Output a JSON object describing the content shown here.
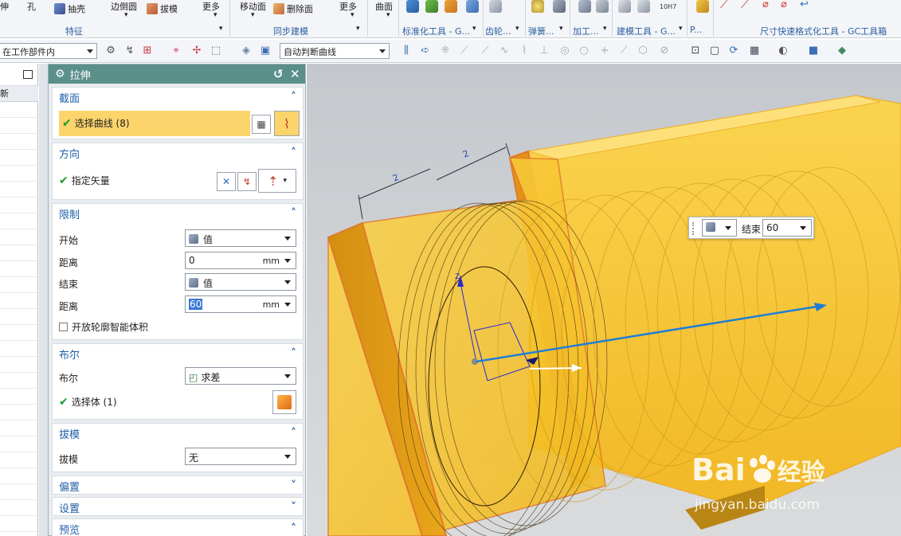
{
  "ribbon": {
    "top_items": [
      {
        "label": "伸",
        "name": "extrude-cut-label"
      },
      {
        "label": "孔",
        "name": "hole-label"
      },
      {
        "label": "抽壳",
        "name": "shell-button"
      },
      {
        "label": "边倒圆",
        "name": "edge-blend-button"
      },
      {
        "label": "拔模",
        "name": "draft-button"
      },
      {
        "label": "更多",
        "name": "more-feature-button"
      },
      {
        "label": "移动面",
        "name": "move-face-button"
      },
      {
        "label": "删除面",
        "name": "delete-face-button"
      },
      {
        "label": "更多",
        "name": "more-sync-button"
      },
      {
        "label": "曲面",
        "name": "surface-button"
      }
    ],
    "groups": [
      {
        "label": "特征",
        "name": "group-feature"
      },
      {
        "label": "同步建模",
        "name": "group-sync-modeling"
      },
      {
        "label": "标准化工具 - G...",
        "name": "group-standard-tools"
      },
      {
        "label": "齿轮...",
        "name": "group-gear"
      },
      {
        "label": "弹簧...",
        "name": "group-spring"
      },
      {
        "label": "加工...",
        "name": "group-machining"
      },
      {
        "label": "建模工具 - G...",
        "name": "group-modeling-tools"
      },
      {
        "label": "P...",
        "name": "group-p"
      },
      {
        "label": "尺寸快速格式化工具 - GC工具箱",
        "name": "group-dimension-format"
      }
    ],
    "badge": "10H7"
  },
  "cmdbar": {
    "scope_select": "在工作部件内",
    "curve_rule_select": "自动判断曲线"
  },
  "navigator": {
    "column_label": "新"
  },
  "dialog": {
    "title": "拉伸",
    "section": {
      "title": "截面",
      "select_curve": "选择曲线 (8)"
    },
    "direction": {
      "title": "方向",
      "specify_vector": "指定矢量"
    },
    "limits": {
      "title": "限制",
      "start_label": "开始",
      "start_value": "值",
      "start_distance_label": "距离",
      "start_distance": "0",
      "end_label": "结束",
      "end_value": "值",
      "end_distance_label": "距离",
      "end_distance": "60",
      "unit": "mm",
      "open_profile": "开放轮廓智能体积"
    },
    "boolean": {
      "title": "布尔",
      "label": "布尔",
      "value": "求差",
      "select_body": "选择体 (1)"
    },
    "draft": {
      "title": "拔模",
      "label": "拔模",
      "value": "无"
    },
    "offset": {
      "title": "偏置"
    },
    "settings": {
      "title": "设置"
    },
    "preview": {
      "title": "预览"
    }
  },
  "viewport": {
    "floating": {
      "label": "结束",
      "value": "60"
    },
    "dimension_label": "2"
  },
  "watermark": {
    "brand": "Bai",
    "brand_suffix": "经验",
    "site": "jingyan.baidu.com"
  },
  "colors": {
    "model_yellow": "#f5c22b",
    "model_edge": "#e07a2a",
    "axis_blue": "#1e7ed6",
    "dialog_title": "#5b8f8a",
    "section_title": "#1f5fa8"
  }
}
